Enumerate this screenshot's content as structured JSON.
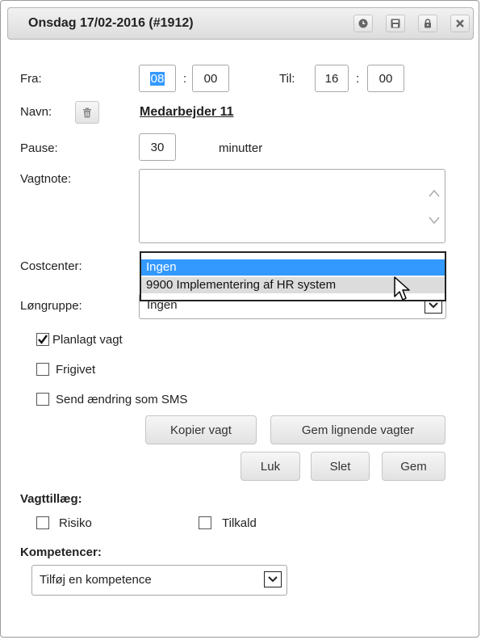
{
  "title": "Onsdag 17/02-2016  (#1912)",
  "titlebar_icons": [
    "clock-icon",
    "save-icon",
    "lock-icon",
    "close-icon"
  ],
  "form": {
    "fra_label": "Fra:",
    "fra_hour": "08",
    "fra_min": "00",
    "colon": ":",
    "til_label": "Til:",
    "til_hour": "16",
    "til_min": "00",
    "navn_label": "Navn:",
    "navn_value": "Medarbejder 11",
    "pause_label": "Pause:",
    "pause_value": "30",
    "pause_unit": "minutter",
    "vagtnote_label": "Vagtnote:",
    "vagtnote_value": "",
    "costcenter_label": "Costcenter:",
    "costcenter_options": [
      "Ingen",
      "9900 Implementering af HR system"
    ],
    "costcenter_selected": "Ingen",
    "loengruppe_label": "Løngruppe:",
    "loengruppe_value": "Ingen",
    "planlagt_label": "Planlagt vagt",
    "planlagt_checked": true,
    "frigivet_label": "Frigivet",
    "frigivet_checked": false,
    "sms_label": "Send ændring som SMS",
    "sms_checked": false
  },
  "buttons": {
    "kopier": "Kopier vagt",
    "gem_lignende": "Gem lignende vagter",
    "luk": "Luk",
    "slet": "Slet",
    "gem": "Gem"
  },
  "vagttillaeg": {
    "heading": "Vagttillæg:",
    "risiko": "Risiko",
    "tilkald": "Tilkald"
  },
  "kompetencer": {
    "heading": "Kompetencer:",
    "select_value": "Tilføj en kompetence"
  },
  "colors": {
    "selection": "#3399ff",
    "hover": "#dcdcdc"
  }
}
